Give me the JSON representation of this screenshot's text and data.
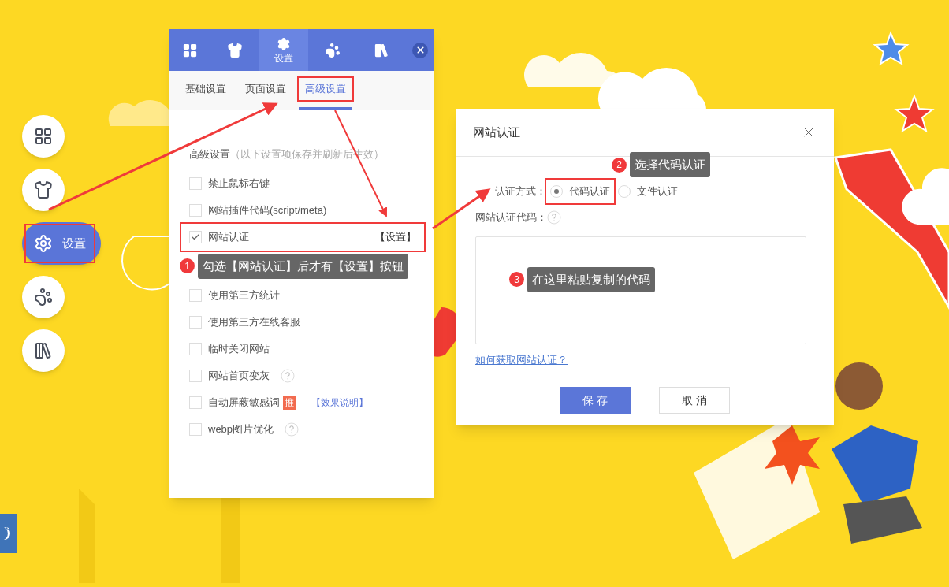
{
  "side_nav": [
    {
      "selected": false,
      "highlighted": false
    },
    {
      "selected": false,
      "highlighted": false
    },
    {
      "selected": true,
      "label": "设置",
      "highlighted": true
    },
    {
      "selected": false,
      "highlighted": false
    },
    {
      "selected": false,
      "highlighted": false
    }
  ],
  "panel": {
    "tabs": [
      {
        "selected": false
      },
      {
        "selected": false
      },
      {
        "selected": true,
        "label": "设置"
      },
      {
        "selected": false
      },
      {
        "selected": false
      }
    ],
    "subtabs": [
      {
        "label": "基础设置",
        "selected": false,
        "highlighted": false
      },
      {
        "label": "页面设置",
        "selected": false,
        "highlighted": false
      },
      {
        "label": "高级设置",
        "selected": true,
        "highlighted": true
      }
    ],
    "section_title": "高级设置",
    "section_note": "（以下设置项保存并刷新后生效）",
    "options": [
      {
        "label": "禁止鼠标右键",
        "checked": false
      },
      {
        "label": "网站插件代码(script/meta)",
        "checked": false
      },
      {
        "label": "网站认证",
        "checked": true,
        "highlighted": true,
        "action": "【设置】",
        "note": {
          "number": "1",
          "text": "勾选【网站认证】后才有【设置】按钮"
        }
      },
      {
        "label": "使用第三方统计",
        "checked": false
      },
      {
        "label": "使用第三方在线客服",
        "checked": false
      },
      {
        "label": "临时关闭网站",
        "checked": false
      },
      {
        "label": "网站首页变灰",
        "checked": false,
        "help": true
      },
      {
        "label": "自动屏蔽敏感词",
        "checked": false,
        "badge": "推",
        "link": "【效果说明】"
      },
      {
        "label": "webp图片优化",
        "checked": false,
        "help": true
      }
    ]
  },
  "dialog": {
    "title": "网站认证",
    "method_label": "认证方式：",
    "methods": [
      {
        "label": "代码认证",
        "selected": true,
        "highlighted": true
      },
      {
        "label": "文件认证",
        "selected": false,
        "highlighted": false
      }
    ],
    "method_note": {
      "number": "2",
      "text": "选择代码认证"
    },
    "code_label": "网站认证代码：",
    "code_note": {
      "number": "3",
      "text": "在这里粘贴复制的代码"
    },
    "help_link": "如何获取网站认证？",
    "buttons": [
      {
        "label": "保 存",
        "kind": "primary"
      },
      {
        "label": "取 消",
        "kind": "secondary"
      }
    ]
  }
}
